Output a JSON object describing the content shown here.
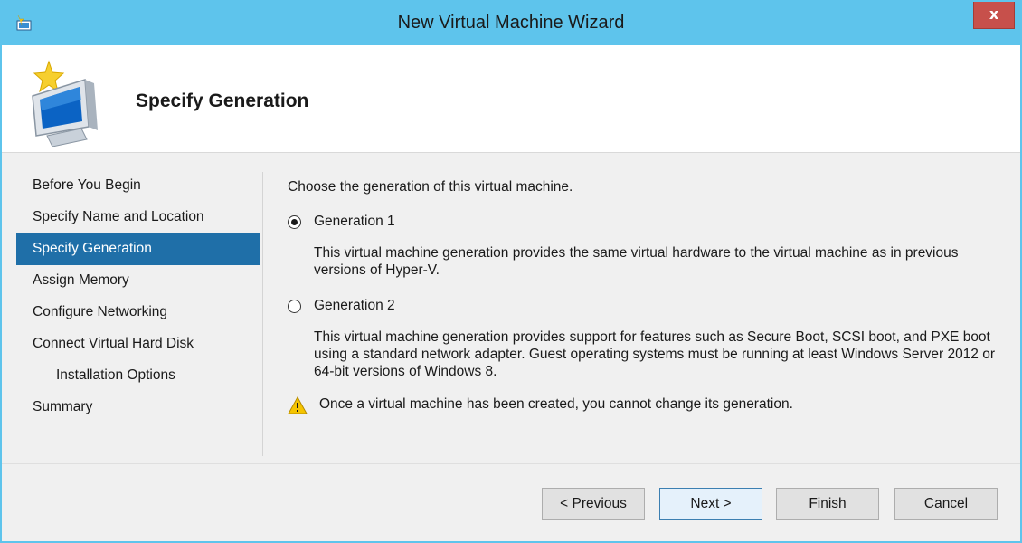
{
  "window": {
    "title": "New Virtual Machine Wizard",
    "close_label": "x"
  },
  "header": {
    "title": "Specify Generation"
  },
  "sidebar": {
    "items": [
      {
        "label": "Before You Begin"
      },
      {
        "label": "Specify Name and Location"
      },
      {
        "label": "Specify Generation",
        "selected": true
      },
      {
        "label": "Assign Memory"
      },
      {
        "label": "Configure Networking"
      },
      {
        "label": "Connect Virtual Hard Disk"
      },
      {
        "label": "Installation Options",
        "indented": true
      },
      {
        "label": "Summary"
      }
    ]
  },
  "content": {
    "prompt": "Choose the generation of this virtual machine.",
    "options": [
      {
        "label": "Generation 1",
        "checked": true,
        "description": "This virtual machine generation provides the same virtual hardware to the virtual machine as in previous versions of Hyper-V."
      },
      {
        "label": "Generation 2",
        "checked": false,
        "description": "This virtual machine generation provides support for features such as Secure Boot, SCSI boot, and PXE boot using a standard network adapter. Guest operating systems must be running at least Windows Server 2012 or 64-bit versions of Windows 8."
      }
    ],
    "warning": "Once a virtual machine has been created, you cannot change its generation."
  },
  "buttons": {
    "previous": "< Previous",
    "next": "Next >",
    "finish": "Finish",
    "cancel": "Cancel"
  },
  "colors": {
    "titlebar": "#5ec4ec",
    "selection": "#1f6fa8",
    "close": "#c7504b",
    "warning": "#f5c400"
  },
  "icons": {
    "app": "hyper-v-app-icon",
    "header": "new-virtual-machine-icon",
    "warning": "warning-icon"
  }
}
